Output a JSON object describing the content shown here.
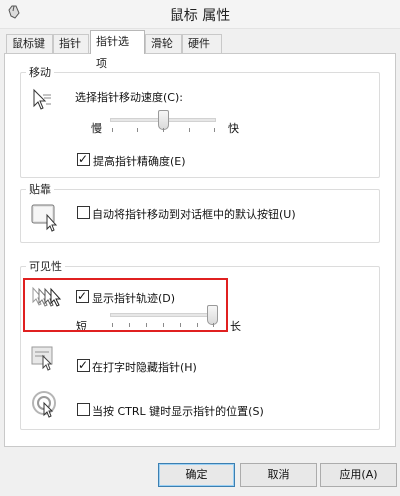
{
  "window": {
    "title": "鼠标 属性",
    "icon": "mouse-icon"
  },
  "tabs": [
    {
      "label": "鼠标键"
    },
    {
      "label": "指针"
    },
    {
      "label": "指针选项",
      "active": true
    },
    {
      "label": "滑轮"
    },
    {
      "label": "硬件"
    }
  ],
  "motion": {
    "title": "移动",
    "speed_label": "选择指针移动速度(C):",
    "slow": "慢",
    "fast": "快",
    "speed_level": 0.5,
    "precision_label": "提高指针精确度(E)",
    "precision_checked": true,
    "icon": "pointer-speed-icon"
  },
  "snap": {
    "title": "贴靠",
    "label": "自动将指针移动到对话框中的默认按钮(U)",
    "checked": false,
    "icon": "snap-to-button-icon"
  },
  "visibility": {
    "title": "可见性",
    "trails_label": "显示指针轨迹(D)",
    "trails_checked": true,
    "short": "短",
    "long": "长",
    "trails_level": 1.0,
    "hide_typing_label": "在打字时隐藏指针(H)",
    "hide_typing_checked": true,
    "ctrl_label": "当按 CTRL 键时显示指针的位置(S)",
    "ctrl_checked": false,
    "trails_icon": "pointer-trails-icon",
    "hide_icon": "hide-pointer-icon",
    "ctrl_icon": "show-location-icon"
  },
  "buttons": {
    "ok": "确定",
    "cancel": "取消",
    "apply": "应用(A)"
  },
  "colors": {
    "highlight": "#e02020",
    "accent": "#3c7fb1"
  }
}
